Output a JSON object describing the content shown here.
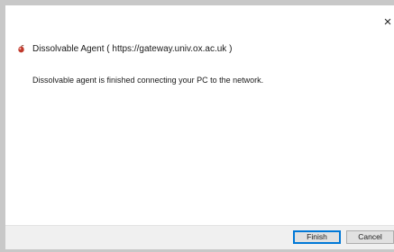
{
  "window": {
    "close_glyph": "×"
  },
  "header": {
    "icon": "dissolvable-agent-icon",
    "title": "Dissolvable Agent  ( https://gateway.univ.ox.ac.uk )"
  },
  "main": {
    "message": "Dissolvable agent is finished connecting your PC to the network."
  },
  "footer": {
    "finish_label": "Finish",
    "cancel_label": "Cancel"
  },
  "colors": {
    "icon_red": "#c0392b",
    "focus_border": "#0078d7",
    "button_bg": "#e1e1e1",
    "footer_bg": "#f0f0f0"
  }
}
